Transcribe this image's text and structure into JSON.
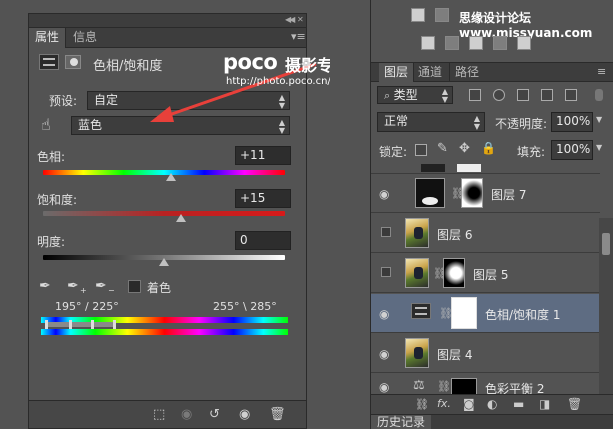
{
  "properties_panel": {
    "tabs": [
      {
        "label": "属性",
        "active": true
      },
      {
        "label": "信息",
        "active": false
      }
    ],
    "adjustment_title": "色相/饱和度",
    "preset_label": "预设:",
    "preset_value": "自定",
    "channel_value": "蓝色",
    "hue": {
      "label": "色相:",
      "value": "+11",
      "level": 0.53
    },
    "saturation": {
      "label": "饱和度:",
      "value": "+15",
      "level": 0.57
    },
    "lightness": {
      "label": "明度:",
      "value": "0",
      "level": 0.5
    },
    "colorize_label": "着色",
    "range_left": "195° / 225°",
    "range_right": "255° \\ 285°"
  },
  "watermark": {
    "logo": "poco",
    "title": "摄影专题",
    "url": "http://photo.poco.cn/",
    "site": "思缘设计论坛 www.missyuan.com"
  },
  "layers_panel": {
    "tabs": [
      {
        "label": "图层",
        "active": true
      },
      {
        "label": "通道",
        "active": false
      },
      {
        "label": "路径",
        "active": false
      }
    ],
    "filter_kind": "类型",
    "blend_mode": "正常",
    "opacity_label": "不透明度:",
    "opacity_value": "100%",
    "lock_label": "锁定:",
    "fill_label": "填充:",
    "fill_value": "100%",
    "layers": [
      {
        "name": "图层 7",
        "visible": true,
        "kind": "masked-black"
      },
      {
        "name": "图层 6",
        "visible": false,
        "kind": "image"
      },
      {
        "name": "图层 5",
        "visible": false,
        "kind": "masked-image"
      },
      {
        "name": "色相/饱和度 1",
        "visible": true,
        "kind": "adjustment",
        "selected": true
      },
      {
        "name": "图层 4",
        "visible": true,
        "kind": "image"
      },
      {
        "name": "色彩平衡 2",
        "visible": true,
        "kind": "balance"
      }
    ],
    "fx_label": "fx."
  },
  "history_panel": {
    "label": "历史记录"
  },
  "colors": {
    "panel_bg": "#535353",
    "dark_bg": "#3d3d3d",
    "selected_row": "#5e6c82",
    "arrow": "#e8403a"
  }
}
